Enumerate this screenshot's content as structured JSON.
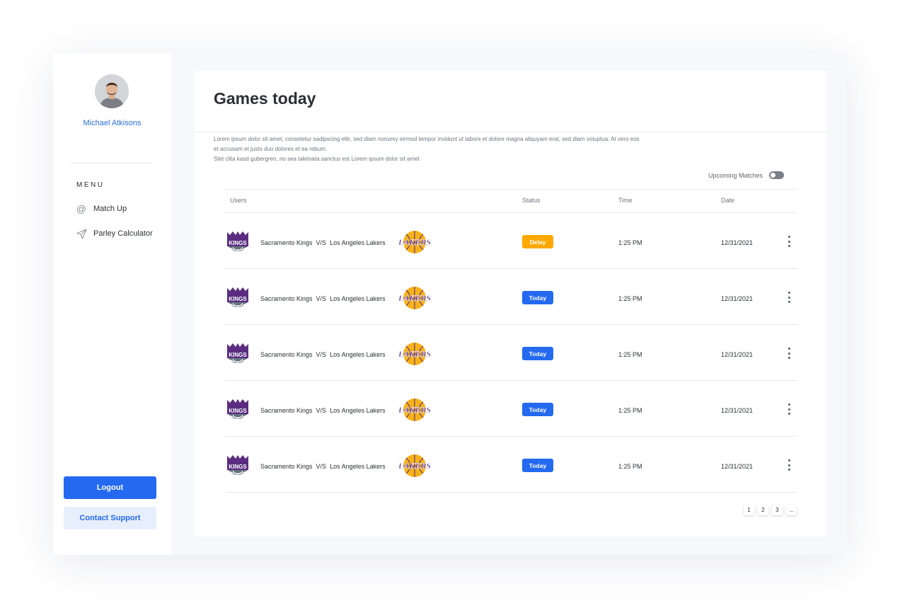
{
  "sidebar": {
    "user_name": "Michael Atkisons",
    "menu_title": "MENU",
    "menu_items": [
      {
        "label": "Match Up",
        "icon": "at-icon"
      },
      {
        "label": "Parley Calculator",
        "icon": "paper-plane-icon"
      }
    ],
    "logout_label": "Logout",
    "support_label": "Contact Support"
  },
  "main": {
    "title": "Games today",
    "description_lines": [
      "Lorem ipsum dolor sit amet, consetetur sadipscing elitr, sed diam nonumy eirmod tempor invidunt ut labore et dolore magna aliquyam erat, sed diam voluptua. At vero eos",
      "et accusam et justo duo dolores et ea rebum.",
      " Stet clita kasd gubergren, no sea takimata sanctus est Lorem ipsum dolor sit amet"
    ],
    "toggle_label": "Upcoming Matches",
    "table": {
      "headers": {
        "users": "Users",
        "status": "Status",
        "time": "Time",
        "date": "Date"
      },
      "rows": [
        {
          "home": "Sacramento Kings",
          "vs": "V/S",
          "away": "Los Angeles Lakers",
          "status": "Delay",
          "time": "1:25 PM",
          "date": "12/31/2021"
        },
        {
          "home": "Sacramento Kings",
          "vs": "V/S",
          "away": "Los Angeles Lakers",
          "status": "Today",
          "time": "1:25 PM",
          "date": "12/31/2021"
        },
        {
          "home": "Sacramento Kings",
          "vs": "V/S",
          "away": "Los Angeles Lakers",
          "status": "Today",
          "time": "1:25 PM",
          "date": "12/31/2021"
        },
        {
          "home": "Sacramento Kings",
          "vs": "V/S",
          "away": "Los Angeles Lakers",
          "status": "Today",
          "time": "1:25 PM",
          "date": "12/31/2021"
        },
        {
          "home": "Sacramento Kings",
          "vs": "V/S",
          "away": "Los Angeles Lakers",
          "status": "Today",
          "time": "1:25 PM",
          "date": "12/31/2021"
        }
      ]
    },
    "pagination": [
      "1",
      "2",
      "3",
      "..."
    ]
  },
  "colors": {
    "accent": "#2469f0",
    "delay": "#ffa800",
    "text": "#2c2f36",
    "link": "#2a6fd6"
  }
}
